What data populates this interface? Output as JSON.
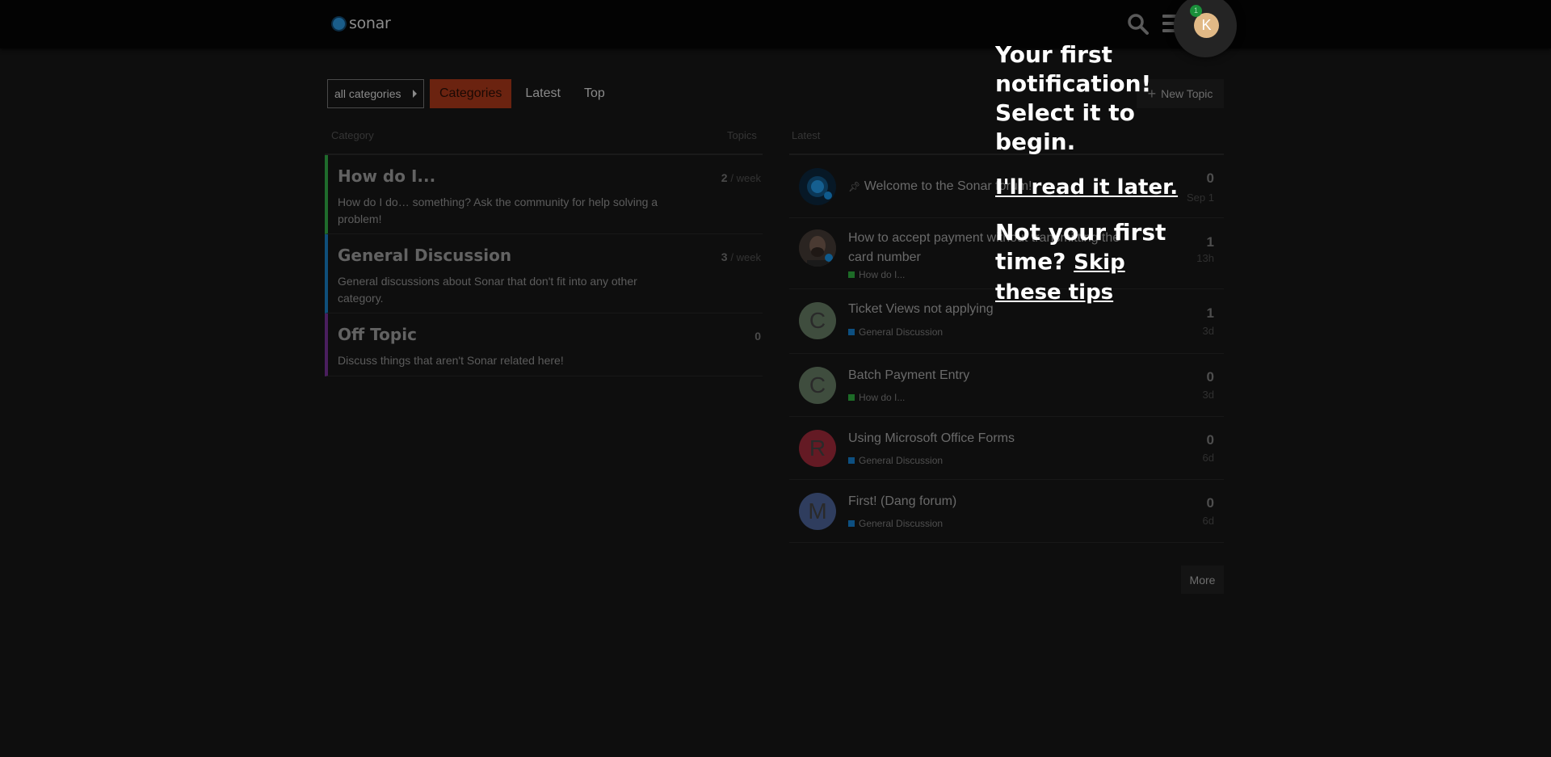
{
  "header": {
    "logo_text": "sonar",
    "user_initial": "K",
    "notification_count": "1"
  },
  "nav": {
    "category_dropdown": "all categories",
    "tabs": [
      "Categories",
      "Latest",
      "Top"
    ],
    "new_topic": "New Topic"
  },
  "columns": {
    "category": "Category",
    "topics": "Topics",
    "latest": "Latest"
  },
  "categories": [
    {
      "name": "How do I...",
      "description": "How do I do… something? Ask the community for help solving a problem!",
      "count": "2",
      "period": "/ week"
    },
    {
      "name": "General Discussion",
      "description": "General discussions about Sonar that don't fit into any other category.",
      "count": "3",
      "period": "/ week"
    },
    {
      "name": "Off Topic",
      "description": "Discuss things that aren't Sonar related here!",
      "count": "0",
      "period": ""
    }
  ],
  "topics": [
    {
      "title": "Welcome to the Sonar forum!",
      "category": "",
      "replies": "0",
      "age": "Sep 1"
    },
    {
      "title": "How to accept payment without transmitting the card number",
      "category": "How do I...",
      "replies": "1",
      "age": "13h"
    },
    {
      "title": "Ticket Views not applying",
      "category": "General Discussion",
      "replies": "1",
      "age": "3d",
      "avatar": "C"
    },
    {
      "title": "Batch Payment Entry",
      "category": "How do I...",
      "replies": "0",
      "age": "3d",
      "avatar": "C"
    },
    {
      "title": "Using Microsoft Office Forms",
      "category": "General Discussion",
      "replies": "0",
      "age": "6d",
      "avatar": "R"
    },
    {
      "title": "First! (Dang forum)",
      "category": "General Discussion",
      "replies": "0",
      "age": "6d",
      "avatar": "M"
    }
  ],
  "more_label": "More",
  "tip": {
    "title": "Your first notification! Select it to begin.",
    "later": "I'll read it later.",
    "not_first": "Not your first time?",
    "skip": "Skip these tips"
  },
  "colors": {
    "accent": "#e45735",
    "how_do_i": "#27a33a",
    "general_discussion": "#0e76bd",
    "off_topic": "#8f3fb3"
  }
}
